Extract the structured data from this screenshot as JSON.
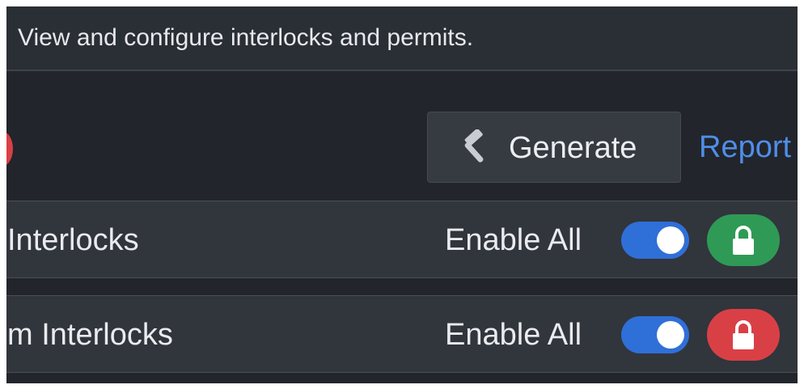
{
  "header": {
    "description": "View and configure interlocks and permits."
  },
  "toolbar": {
    "generate_label": "Generate",
    "generate_icon": "hammer-icon",
    "report_label": "Report"
  },
  "groups": [
    {
      "title": "Interlocks",
      "enable_label": "Enable All",
      "enabled": true,
      "lock_state": "unlocked",
      "lock_color": "#2f9a55",
      "lock_icon": "lock-icon"
    },
    {
      "title": "m Interlocks",
      "enable_label": "Enable All",
      "enabled": true,
      "lock_state": "locked",
      "lock_color": "#d94046",
      "lock_icon": "lock-icon"
    }
  ],
  "colors": {
    "background": "#22252b",
    "accent": "#2f6fd8",
    "link": "#4f8ee8",
    "success": "#2f9a55",
    "danger": "#d94046"
  }
}
